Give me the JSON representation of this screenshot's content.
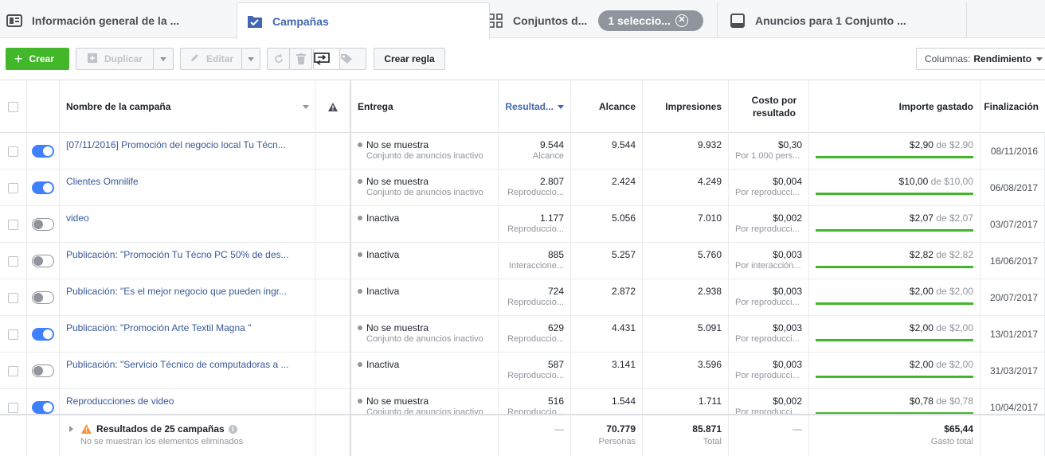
{
  "tabs": [
    {
      "label": "Información general de la ...",
      "icon": "overview-icon"
    },
    {
      "label": "Campañas",
      "icon": "campaign-check-icon"
    },
    {
      "label": "Conjuntos d...",
      "icon": "adset-grid-icon",
      "selection_pill": "1 seleccio..."
    },
    {
      "label": "Anuncios para 1 Conjunto ...",
      "icon": "ad-monitor-icon"
    }
  ],
  "toolbar": {
    "create_label": "Crear",
    "duplicate_label": "Duplicar",
    "edit_label": "Editar",
    "rule_label": "Crear regla",
    "columns_prefix": "Columnas:",
    "columns_value": "Rendimiento"
  },
  "headers": {
    "name": "Nombre de la campaña",
    "delivery": "Entrega",
    "results": "Resultad...",
    "reach": "Alcance",
    "impressions": "Impresiones",
    "cost": "Costo por resultado",
    "spent": "Importe gastado",
    "end": "Finalización"
  },
  "rows": [
    {
      "on": true,
      "name": "[07/11/2016] Promoción del negocio local Tu Técn...",
      "status": "No se muestra",
      "status_sub": "Conjunto de anuncios inactivo",
      "results": "9.544",
      "results_sub": "Alcance",
      "reach": "9.544",
      "impressions": "9.932",
      "cost": "$0,30",
      "cost_sub": "Por 1.000 pers...",
      "spent": "$2,90",
      "of_word": "de",
      "budget": "$2,90",
      "spent_fraction": 1.0,
      "end": "08/11/2016"
    },
    {
      "on": true,
      "name": "Clientes Omnilife",
      "status": "No se muestra",
      "status_sub": "Conjunto de anuncios inactivo",
      "results": "2.807",
      "results_sub": "Reproduccio...",
      "reach": "2.424",
      "impressions": "4.249",
      "cost": "$0,004",
      "cost_sub": "Por reproducci...",
      "spent": "$10,00",
      "of_word": "de",
      "budget": "$10,00",
      "spent_fraction": 1.0,
      "end": "06/08/2017"
    },
    {
      "on": false,
      "name": "video",
      "status": "Inactiva",
      "status_sub": "",
      "results": "1.177",
      "results_sub": "Reproduccio...",
      "reach": "5.056",
      "impressions": "7.010",
      "cost": "$0,002",
      "cost_sub": "Por reproducci...",
      "spent": "$2,07",
      "of_word": "de",
      "budget": "$2,07",
      "spent_fraction": 1.0,
      "end": "03/07/2017"
    },
    {
      "on": false,
      "name": "Publicación: \"Promoción Tu Técno PC 50% de des...",
      "status": "Inactiva",
      "status_sub": "",
      "results": "885",
      "results_sub": "Interaccione...",
      "reach": "5.257",
      "impressions": "5.760",
      "cost": "$0,003",
      "cost_sub": "Por interacción...",
      "spent": "$2,82",
      "of_word": "de",
      "budget": "$2,82",
      "spent_fraction": 1.0,
      "end": "16/06/2017"
    },
    {
      "on": false,
      "name": "Publicación: \"Es el mejor negocio que pueden ingr...",
      "status": "Inactiva",
      "status_sub": "",
      "results": "724",
      "results_sub": "Reproduccio...",
      "reach": "2.872",
      "impressions": "2.938",
      "cost": "$0,003",
      "cost_sub": "Por reproducci...",
      "spent": "$2,00",
      "of_word": "de",
      "budget": "$2,00",
      "spent_fraction": 1.0,
      "end": "20/07/2017"
    },
    {
      "on": true,
      "name": "Publicación: \"Promoción Arte Textil Magna \"",
      "status": "No se muestra",
      "status_sub": "Conjunto de anuncios inactivo",
      "results": "629",
      "results_sub": "Reproduccio...",
      "reach": "4.431",
      "impressions": "5.091",
      "cost": "$0,003",
      "cost_sub": "Por reproducci...",
      "spent": "$2,00",
      "of_word": "de",
      "budget": "$2,00",
      "spent_fraction": 1.0,
      "end": "13/01/2017"
    },
    {
      "on": false,
      "name": "Publicación: \"Servicio Técnico de computadoras a ...",
      "status": "Inactiva",
      "status_sub": "",
      "results": "587",
      "results_sub": "Reproduccio...",
      "reach": "3.141",
      "impressions": "3.596",
      "cost": "$0,003",
      "cost_sub": "Por reproducci...",
      "spent": "$2,00",
      "of_word": "de",
      "budget": "$2,00",
      "spent_fraction": 1.0,
      "end": "31/03/2017"
    },
    {
      "on": true,
      "name": "Reproducciones de video",
      "status": "No se muestra",
      "status_sub": "Conjunto de anuncios inactivo",
      "results": "516",
      "results_sub": "Reproduccio...",
      "reach": "1.544",
      "impressions": "1.711",
      "cost": "$0,002",
      "cost_sub": "Por reproducci...",
      "spent": "$0,78",
      "of_word": "de",
      "budget": "$0,78",
      "spent_fraction": 1.0,
      "end": "10/04/2017"
    }
  ],
  "footer": {
    "title": "Resultados de 25 campañas",
    "subtitle": "No se muestran los elementos eliminados",
    "results": "—",
    "reach": "70.779",
    "reach_sub": "Personas",
    "impressions": "85.871",
    "impressions_sub": "Total",
    "cost": "—",
    "spent": "$65,44",
    "spent_sub": "Gasto total"
  },
  "colors": {
    "accent": "#4267b2",
    "create": "#42b72a",
    "toggle_on": "#4080ff",
    "link": "#365899"
  }
}
